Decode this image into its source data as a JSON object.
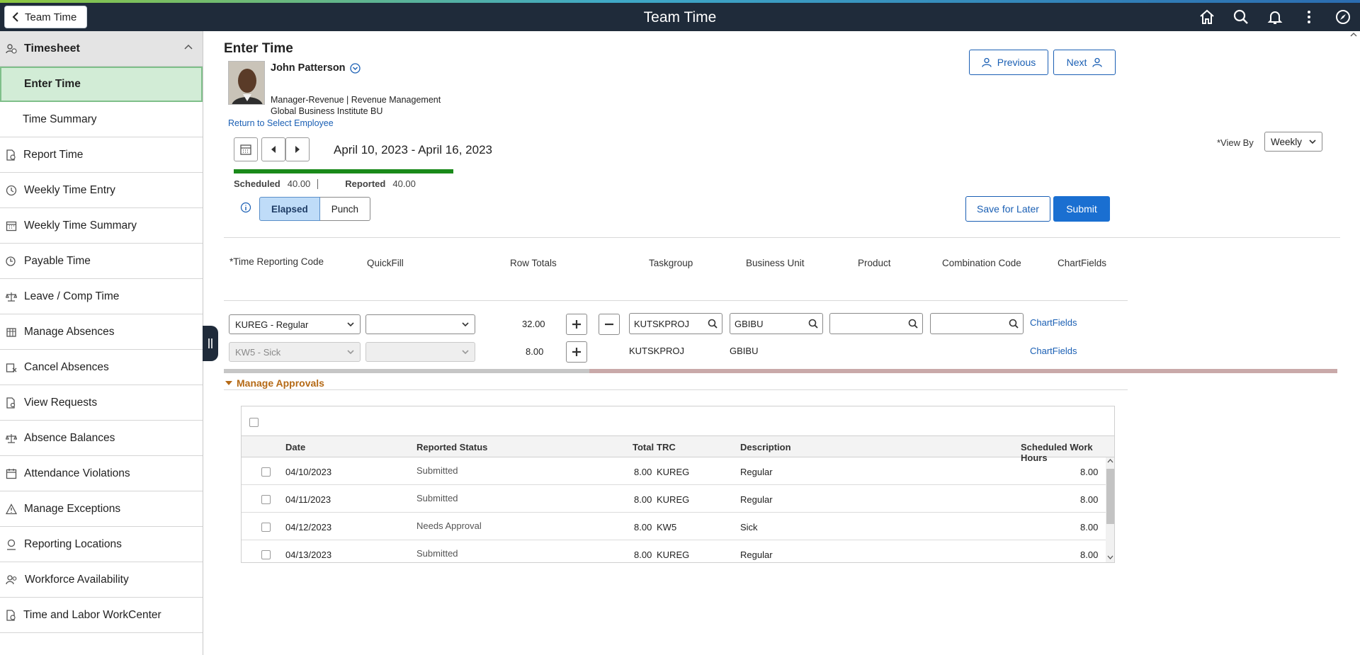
{
  "banner": {
    "back_label": "Team Time",
    "title": "Team Time",
    "icons": [
      "home-icon",
      "search-icon",
      "bell-icon",
      "more-vertical-icon",
      "navbar-compass-icon"
    ]
  },
  "sidebar": {
    "section_title": "Timesheet",
    "items": [
      {
        "label": "Enter Time",
        "active": true
      },
      {
        "label": "Time Summary"
      },
      {
        "label": "Report Time"
      },
      {
        "label": "Weekly Time Entry"
      },
      {
        "label": "Weekly Time Summary"
      },
      {
        "label": "Payable Time"
      },
      {
        "label": "Leave / Comp Time"
      },
      {
        "label": "Manage Absences"
      },
      {
        "label": "Cancel Absences"
      },
      {
        "label": "View Requests"
      },
      {
        "label": "Absence Balances"
      },
      {
        "label": "Attendance Violations"
      },
      {
        "label": "Manage Exceptions"
      },
      {
        "label": "Reporting Locations"
      },
      {
        "label": "Workforce Availability"
      },
      {
        "label": "Time and Labor WorkCenter"
      }
    ]
  },
  "page": {
    "title": "Enter Time",
    "employee": {
      "name": "John Patterson",
      "job": "Manager-Revenue | Revenue Management",
      "bu": "Global Business Institute BU",
      "return_link": "Return to Select Employee"
    },
    "prev_label": "Previous",
    "next_label": "Next",
    "date_range": "April 10, 2023 - April 16, 2023",
    "scheduled_label": "Scheduled",
    "scheduled_value": "40.00",
    "reported_label": "Reported",
    "reported_value": "40.00",
    "progress_fraction": 1.0,
    "view_by_label": "*View By",
    "view_by_value": "Weekly",
    "mode_elapsed": "Elapsed",
    "mode_punch": "Punch",
    "save_later": "Save for Later",
    "submit": "Submit"
  },
  "time_grid": {
    "columns": [
      "*Time Reporting Code",
      "QuickFill",
      "Row Totals",
      "Taskgroup",
      "Business Unit",
      "Product",
      "Combination Code",
      "ChartFields"
    ],
    "rows": [
      {
        "trc": "KUREG - Regular",
        "quickfill": "",
        "total": "32.00",
        "taskgroup": "KUTSKPROJ",
        "bu": "GBIBU",
        "product": "",
        "combo": "",
        "chartfields": "ChartFields"
      },
      {
        "trc": "KW5 - Sick",
        "quickfill": "",
        "total": "8.00",
        "taskgroup": "KUTSKPROJ",
        "bu": "GBIBU",
        "chartfields": "ChartFields"
      }
    ]
  },
  "approvals": {
    "title": "Manage Approvals",
    "columns": [
      "Date",
      "Reported Status",
      "Total",
      "TRC",
      "Description",
      "Scheduled Work Hours"
    ],
    "rows": [
      {
        "date": "04/10/2023",
        "status": "Submitted",
        "total": "8.00",
        "trc": "KUREG",
        "desc": "Regular",
        "hours": "8.00"
      },
      {
        "date": "04/11/2023",
        "status": "Submitted",
        "total": "8.00",
        "trc": "KUREG",
        "desc": "Regular",
        "hours": "8.00"
      },
      {
        "date": "04/12/2023",
        "status": "Needs Approval",
        "total": "8.00",
        "trc": "KW5",
        "desc": "Sick",
        "hours": "8.00"
      },
      {
        "date": "04/13/2023",
        "status": "Submitted",
        "total": "8.00",
        "trc": "KUREG",
        "desc": "Regular",
        "hours": "8.00"
      }
    ]
  },
  "colors": {
    "banner": "#1f2b3a",
    "accent": "#1a6fd1",
    "progress": "#1a8a1a",
    "section": "#b56a16"
  }
}
